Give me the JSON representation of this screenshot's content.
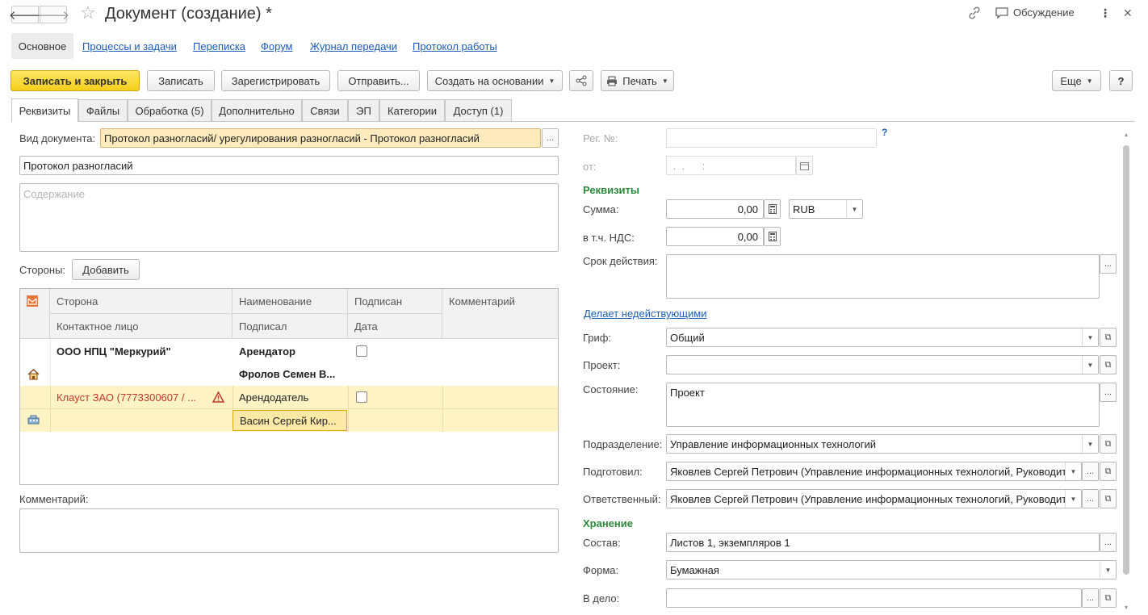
{
  "window": {
    "title": "Документ (создание) *",
    "discussion": "Обсуждение"
  },
  "sections": [
    "Основное",
    "Процессы и задачи",
    "Переписка",
    "Форум",
    "Журнал передачи",
    "Протокол работы"
  ],
  "toolbar": {
    "save_close": "Записать и закрыть",
    "save": "Записать",
    "register": "Зарегистрировать",
    "send": "Отправить...",
    "create_based": "Создать на основании",
    "print": "Печать",
    "more": "Еще",
    "help": "?"
  },
  "tabs": [
    "Реквизиты",
    "Файлы",
    "Обработка (5)",
    "Дополнительно",
    "Связи",
    "ЭП",
    "Категории",
    "Доступ (1)"
  ],
  "left": {
    "doc_type_label": "Вид документа:",
    "doc_type_value": "Протокол разногласий/ урегулирования разногласий - Протокол разногласий",
    "title_value": "Протокол разногласий",
    "content_placeholder": "Содержание",
    "parties_label": "Стороны:",
    "add_button": "Добавить",
    "comment_label": "Комментарий:"
  },
  "grid": {
    "headers": {
      "side": "Сторона",
      "contact": "Контактное лицо",
      "name": "Наименование",
      "signer": "Подписал",
      "signed": "Подписан",
      "date": "Дата",
      "comment": "Комментарий"
    },
    "rows": [
      {
        "side": "ООО НПЦ \"Меркурий\"",
        "name": "Арендатор",
        "signer": "Фролов Семен В...",
        "signed": false
      },
      {
        "side": "Клауст ЗАО (7773300607 / ...",
        "name": "Арендодатель",
        "signer": "Васин Сергей Кир...",
        "signed": false
      }
    ]
  },
  "right": {
    "reg_no_label": "Рег. №:",
    "reg_no_value": "",
    "help_mark": "?",
    "from_label": "от:",
    "from_value": " .  .      :  ",
    "requisites_title": "Реквизиты",
    "sum_label": "Сумма:",
    "sum_value": "0,00",
    "currency": "RUB",
    "vat_label": "в т.ч. НДС:",
    "vat_value": "0,00",
    "validity_label": "Срок действия:",
    "invalidates_link": "Делает недействующими",
    "stamp_label": "Гриф:",
    "stamp_value": "Общий",
    "project_label": "Проект:",
    "project_value": "",
    "state_label": "Состояние:",
    "state_value": "Проект",
    "department_label": "Подразделение:",
    "department_value": "Управление информационных технологий",
    "prepared_label": "Подготовил:",
    "prepared_value": "Яковлев Сергей Петрович (Управление информационных технологий, Руководите",
    "responsible_label": "Ответственный:",
    "responsible_value": "Яковлев Сергей Петрович (Управление информационных технологий, Руководите",
    "storage_title": "Хранение",
    "composition_label": "Состав:",
    "composition_value": "Листов 1, экземпляров 1",
    "form_label": "Форма:",
    "form_value": "Бумажная",
    "case_label": "В дело:",
    "case_value": ""
  },
  "colors": {
    "primary_button": "#f5cf1c",
    "link": "#1c5bb8",
    "section_green": "#2a8a3a",
    "highlight_row": "#fdf3c4",
    "warning_red": "#c0392b"
  }
}
